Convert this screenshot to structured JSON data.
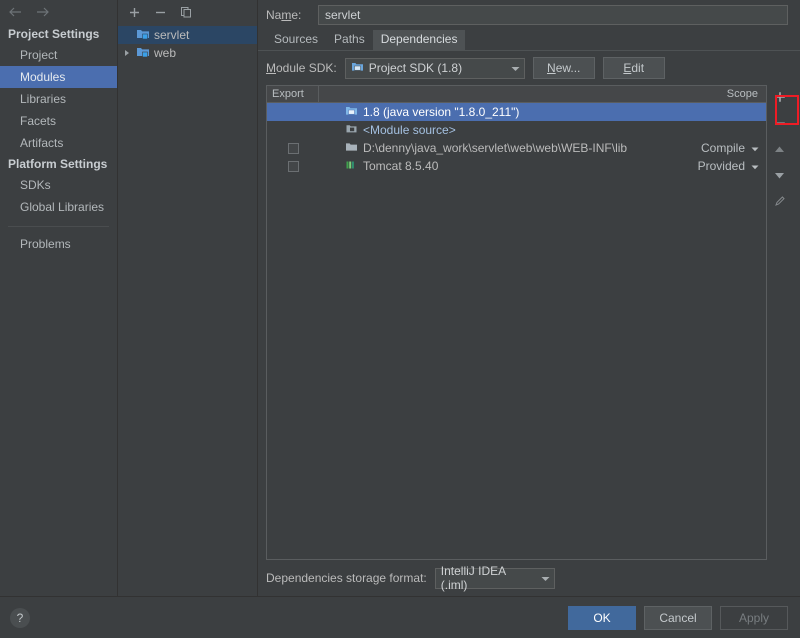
{
  "sidebar": {
    "back_icon": "arrow-left-icon",
    "forward_icon": "arrow-right-icon",
    "groups": [
      {
        "title": "Project Settings",
        "items": [
          {
            "label": "Project",
            "selected": false
          },
          {
            "label": "Modules",
            "selected": true
          },
          {
            "label": "Libraries",
            "selected": false
          },
          {
            "label": "Facets",
            "selected": false
          },
          {
            "label": "Artifacts",
            "selected": false
          }
        ]
      },
      {
        "title": "Platform Settings",
        "items": [
          {
            "label": "SDKs",
            "selected": false
          },
          {
            "label": "Global Libraries",
            "selected": false
          }
        ]
      }
    ],
    "problems_label": "Problems"
  },
  "tree": {
    "toolbar": [
      {
        "name": "add-module-button",
        "icon": "plus-icon"
      },
      {
        "name": "remove-module-button",
        "icon": "minus-icon"
      },
      {
        "name": "copy-module-button",
        "icon": "copy-icon"
      }
    ],
    "items": [
      {
        "label": "servlet",
        "selected": true,
        "expandable": false,
        "icon": "module-folder-icon"
      },
      {
        "label": "web",
        "selected": false,
        "expandable": true,
        "icon": "module-folder-icon"
      }
    ]
  },
  "main": {
    "name_label": "Name:",
    "name_mnemonic": "m",
    "name_value": "servlet",
    "tabs": [
      {
        "label": "Sources",
        "active": false
      },
      {
        "label": "Paths",
        "active": false
      },
      {
        "label": "Dependencies",
        "active": true
      }
    ],
    "sdk_label": "Module SDK:",
    "sdk_value": "Project SDK (1.8)",
    "sdk_icon": "sdk-icon",
    "new_button": "New...",
    "edit_button": "Edit",
    "table": {
      "columns": {
        "export": "Export",
        "scope": "Scope"
      },
      "rows": [
        {
          "name": "1.8 (java version \"1.8.0_211\")",
          "icon": "sdk-icon",
          "checkbox": null,
          "scope": null,
          "selected": true
        },
        {
          "name": "<Module source>",
          "icon": "module-source-icon",
          "checkbox": null,
          "scope": null,
          "selected": false
        },
        {
          "name": "D:\\denny\\java_work\\servlet\\web\\web\\WEB-INF\\lib",
          "icon": "folder-icon",
          "checkbox": false,
          "scope": "Compile",
          "selected": false
        },
        {
          "name": "Tomcat 8.5.40",
          "icon": "library-icon",
          "checkbox": false,
          "scope": "Provided",
          "selected": false
        }
      ]
    },
    "side_toolbar": [
      {
        "name": "add-dependency-button",
        "icon": "plus-icon",
        "highlighted": true
      },
      {
        "name": "remove-dependency-button",
        "icon": "minus-icon",
        "highlighted": false
      },
      {
        "name": "move-up-button",
        "icon": "arrow-up-icon",
        "highlighted": false
      },
      {
        "name": "move-down-button",
        "icon": "arrow-down-icon",
        "highlighted": false
      },
      {
        "name": "edit-dependency-button",
        "icon": "pencil-icon",
        "highlighted": false
      }
    ],
    "storage_label": "Dependencies storage format:",
    "storage_value": "IntelliJ IDEA (.iml)"
  },
  "footer": {
    "help_label": "?",
    "ok_label": "OK",
    "cancel_label": "Cancel",
    "apply_label": "Apply"
  },
  "colors": {
    "selection_focused": "#4b6eaf",
    "selection_unfocused": "#2b4664",
    "background": "#3c3f41",
    "accent_primary": "#41699c",
    "highlight_box": "#ee1c25"
  }
}
